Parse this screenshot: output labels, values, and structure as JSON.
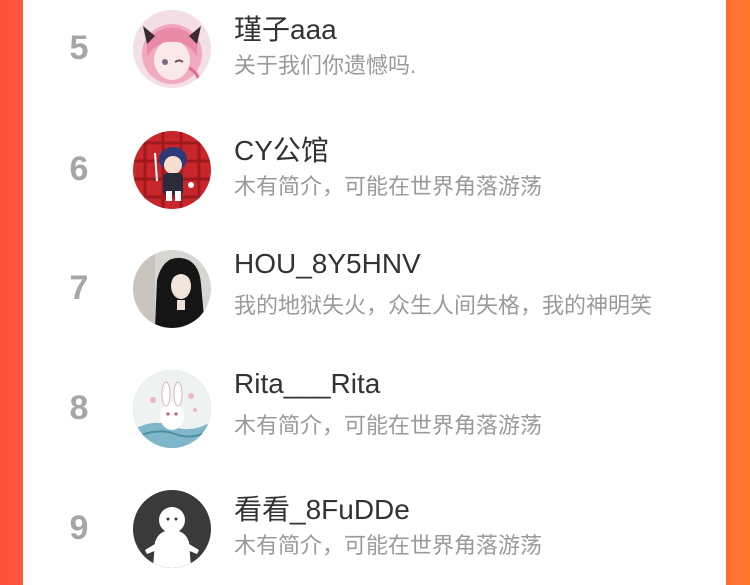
{
  "ranking": {
    "items": [
      {
        "rank": "5",
        "name": "瑾子aaa",
        "bio": "关于我们你遗憾吗.",
        "avatar_icon": "anime-girl-pink-hair-avatar"
      },
      {
        "rank": "6",
        "name": "CY公馆",
        "bio": "木有简介，可能在世界角落游荡",
        "avatar_icon": "anime-boy-red-plaid-avatar"
      },
      {
        "rank": "7",
        "name": "HOU_8Y5HNV",
        "bio": "我的地狱失火，众生人间失格，我的神明笑",
        "avatar_icon": "girl-photo-avatar"
      },
      {
        "rank": "8",
        "name": "Rita___Rita",
        "bio": "木有简介，可能在世界角落游荡",
        "avatar_icon": "white-rabbit-illustration-avatar"
      },
      {
        "rank": "9",
        "name": "看看_8FuDDe",
        "bio": "木有简介，可能在世界角落游荡",
        "avatar_icon": "default-ghost-avatar"
      }
    ]
  },
  "colors": {
    "background_left": "#ff4d3f",
    "background_right": "#ff7a2c",
    "rank_gray": "#a6a6a6",
    "name_text": "#333333",
    "bio_text": "#9a9a9a"
  }
}
